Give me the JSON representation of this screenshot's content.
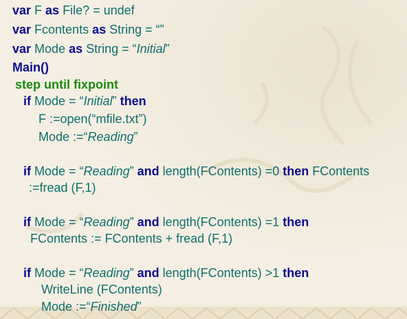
{
  "code": {
    "l1": {
      "kw1": "var",
      "t1": " F ",
      "kw2": "as",
      "t2": " File? = undef"
    },
    "l2": {
      "kw1": "var",
      "t1": " Fcontents ",
      "kw2": "as",
      "t2": " String = “”"
    },
    "l3": {
      "kw1": "var",
      "t1": " Mode ",
      "kw2": "as",
      "t2": " String = “",
      "it": "Initial",
      "t3": "”"
    },
    "l4": {
      "t": "Main()"
    },
    "l5": {
      "t": "step until fixpoint"
    },
    "l6": {
      "kw1": "if",
      "t1": " Mode = “",
      "it": "Initial",
      "t2": "” ",
      "kw2": "then"
    },
    "l7": {
      "t": "F :=open(“mfile.txt”)"
    },
    "l8": {
      "t1": "Mode :=“",
      "it": "Reading",
      "t2": "”"
    },
    "l9": {
      "kw1": "if",
      "t1": " Mode = “",
      "it": "Reading",
      "t2": "” ",
      "kw2": "and",
      "t3": " length(FContents) =0 ",
      "kw3": "then",
      "t4": " FContents"
    },
    "l10": {
      "t": ":=fread (F,1)"
    },
    "l11": {
      "kw1": "if",
      "t1": " Mode = “",
      "it": "Reading",
      "t2": "” ",
      "kw2": "and",
      "t3": " length(FContents) =1 ",
      "kw3": "then"
    },
    "l12": {
      "t": "FContents := FContents + fread (F,1)"
    },
    "l13": {
      "kw1": "if",
      "t1": " Mode = “",
      "it": "Reading",
      "t2": "” ",
      "kw2": "and",
      "t3": " length(FContents) >1 ",
      "kw3": "then"
    },
    "l14": {
      "t": "WriteLine (FContents)"
    },
    "l15": {
      "t1": "Mode :=“",
      "it": "Finished",
      "t2": "”"
    }
  },
  "colors": {
    "keyword": "#0b0b8f",
    "text": "#0e6f6e",
    "step": "#1f8a15",
    "background": "#f4efe2"
  }
}
